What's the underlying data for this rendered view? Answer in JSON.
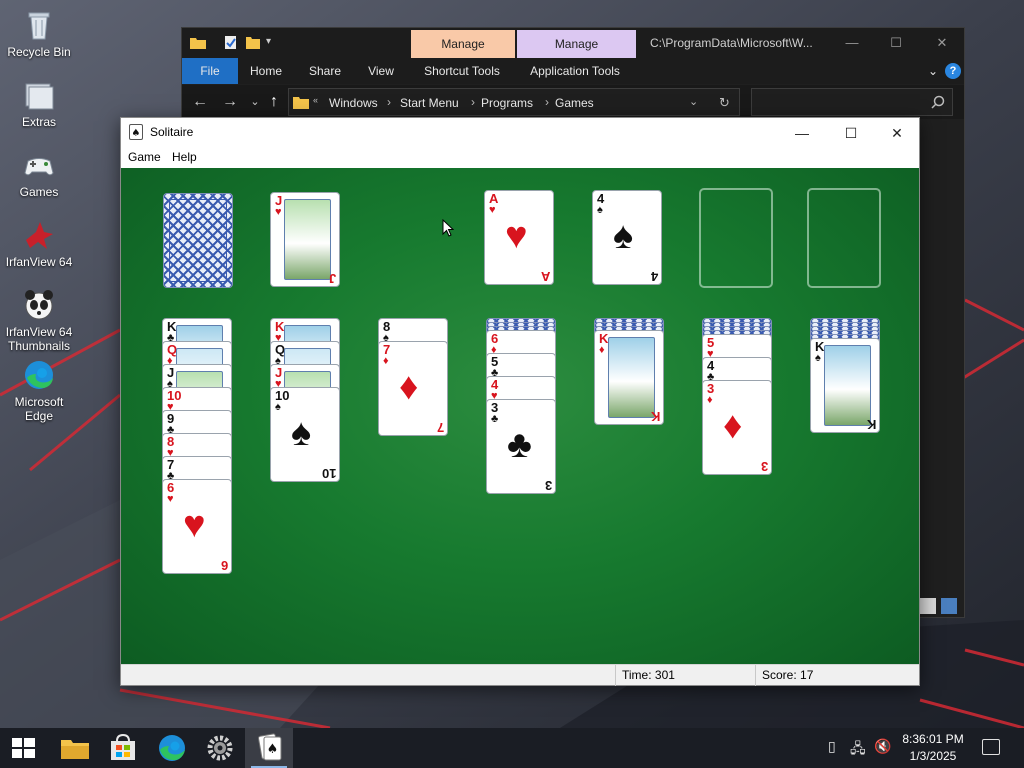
{
  "desktop": {
    "icons": [
      {
        "label": "Recycle Bin"
      },
      {
        "label": "Extras"
      },
      {
        "label": "Games"
      },
      {
        "label": "IrfanView 64"
      },
      {
        "label": "IrfanView 64 Thumbnails"
      },
      {
        "label": "Microsoft Edge"
      }
    ]
  },
  "explorer": {
    "context_tabs": [
      {
        "label": "Manage",
        "color": "#f9c9a8"
      },
      {
        "label": "Manage",
        "color": "#dcc8f2"
      }
    ],
    "title": "C:\\ProgramData\\Microsoft\\W...",
    "ribbon_tabs": [
      "File",
      "Home",
      "Share",
      "View",
      "Shortcut Tools",
      "Application Tools"
    ],
    "breadcrumbs": [
      "Windows",
      "Start Menu",
      "Programs",
      "Games"
    ],
    "accent": "#1f6fc5"
  },
  "solitaire": {
    "title": "Solitaire",
    "menu": [
      "Game",
      "Help"
    ],
    "status": {
      "time": "Time:  301",
      "score": "Score: 17"
    },
    "table_color": "#177a2f",
    "stock": {
      "type": "back"
    },
    "waste": {
      "rank": "J",
      "suit": "♥",
      "color": "red"
    },
    "foundations": [
      {
        "rank": "A",
        "suit": "♥",
        "color": "red"
      },
      {
        "rank": "4",
        "suit": "♠",
        "color": "black"
      },
      {
        "empty": true
      },
      {
        "empty": true
      }
    ],
    "tableau": [
      {
        "hidden": 0,
        "cards": [
          {
            "rank": "K",
            "suit": "♣",
            "color": "black"
          },
          {
            "rank": "Q",
            "suit": "♦",
            "color": "red"
          },
          {
            "rank": "J",
            "suit": "♠",
            "color": "black"
          },
          {
            "rank": "10",
            "suit": "♥",
            "color": "red"
          },
          {
            "rank": "9",
            "suit": "♣",
            "color": "black"
          },
          {
            "rank": "8",
            "suit": "♥",
            "color": "red"
          },
          {
            "rank": "7",
            "suit": "♣",
            "color": "black"
          },
          {
            "rank": "6",
            "suit": "♥",
            "color": "red"
          }
        ]
      },
      {
        "hidden": 0,
        "cards": [
          {
            "rank": "K",
            "suit": "♥",
            "color": "red"
          },
          {
            "rank": "Q",
            "suit": "♠",
            "color": "black"
          },
          {
            "rank": "J",
            "suit": "♥",
            "color": "red"
          },
          {
            "rank": "10",
            "suit": "♠",
            "color": "black"
          }
        ]
      },
      {
        "hidden": 0,
        "cards": [
          {
            "rank": "8",
            "suit": "♠",
            "color": "black"
          },
          {
            "rank": "7",
            "suit": "♦",
            "color": "red"
          }
        ]
      },
      {
        "hidden": 3,
        "cards": [
          {
            "rank": "6",
            "suit": "♦",
            "color": "red"
          },
          {
            "rank": "5",
            "suit": "♣",
            "color": "black"
          },
          {
            "rank": "4",
            "suit": "♥",
            "color": "red"
          },
          {
            "rank": "3",
            "suit": "♣",
            "color": "black"
          }
        ]
      },
      {
        "hidden": 3,
        "cards": [
          {
            "rank": "K",
            "suit": "♦",
            "color": "red"
          }
        ]
      },
      {
        "hidden": 4,
        "cards": [
          {
            "rank": "5",
            "suit": "♥",
            "color": "red"
          },
          {
            "rank": "4",
            "suit": "♣",
            "color": "black"
          },
          {
            "rank": "3",
            "suit": "♦",
            "color": "red"
          }
        ]
      },
      {
        "hidden": 5,
        "cards": [
          {
            "rank": "K",
            "suit": "♠",
            "color": "black"
          }
        ]
      }
    ]
  },
  "taskbar": {
    "apps": [
      {
        "name": "File Explorer"
      },
      {
        "name": "Microsoft Store"
      },
      {
        "name": "Microsoft Edge"
      },
      {
        "name": "Settings"
      },
      {
        "name": "Solitaire",
        "active": true
      }
    ],
    "clock_time": "8:36:01 PM",
    "clock_date": "1/3/2025"
  }
}
